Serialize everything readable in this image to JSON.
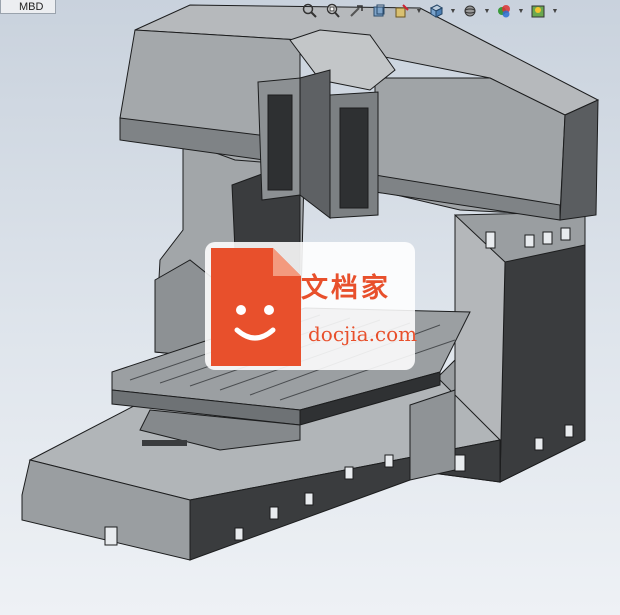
{
  "tab": {
    "label": "MBD"
  },
  "toolbar": {
    "buttons": [
      {
        "icon": "zoom-to-fit-icon"
      },
      {
        "icon": "zoom-to-area-icon"
      },
      {
        "icon": "previous-view-icon"
      },
      {
        "icon": "section-view-icon"
      },
      {
        "icon": "dynamic-annotation-icon"
      },
      {
        "icon": "view-orientation-icon"
      },
      {
        "icon": "display-style-icon"
      },
      {
        "icon": "hide-show-items-icon"
      },
      {
        "icon": "edit-appearance-icon"
      },
      {
        "icon": "apply-scene-icon"
      }
    ]
  },
  "watermark": {
    "title": "文档家",
    "site": "docjia.com",
    "color": "#e8502c"
  },
  "colors": {
    "steel_light": "#a9adb0",
    "steel_mid": "#8a8e91",
    "steel_dark": "#3a3c3e",
    "background": "#dbe2ea"
  }
}
